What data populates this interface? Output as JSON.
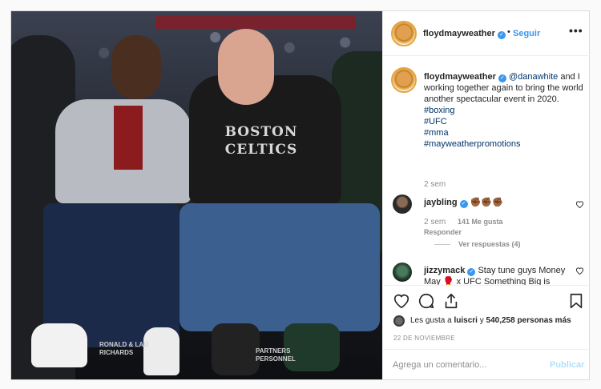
{
  "post": {
    "author": "floydmayweather",
    "follow_label": "Seguir",
    "separator": "•",
    "more_label": "•••",
    "caption": {
      "author": "floydmayweather",
      "mention": "@danawhite",
      "text": " and I working together again to bring the world another spectacular event in 2020.",
      "tags": [
        "#boxing",
        "#UFC",
        "#mma",
        "#mayweatherpromotions"
      ],
      "time": "2 sem"
    },
    "comments": [
      {
        "user": "jaybling",
        "text": "✊🏾✊🏾✊🏾",
        "time": "2 sem",
        "likes": "141 Me gusta",
        "reply_label": "Responder",
        "view_replies": "Ver respuestas (4)"
      },
      {
        "user": "jizzymack",
        "text_before": "Stay tune guys Money May ",
        "text_after": " x UFC Something Big is about to be",
        "emoji": "🥊"
      }
    ],
    "likes_text_prefix": "Les gusta a ",
    "likes_user": "luiscri",
    "likes_text_mid": " y ",
    "likes_count": "540,258 personas más",
    "date": "22 DE NOVIEMBRE",
    "comment_placeholder": "Agrega un comentario...",
    "publish_label": "Publicar",
    "photo": {
      "shirt_line1": "BOSTON",
      "shirt_line2": "CELTICS",
      "sign_left_1": "RONALD & LAU",
      "sign_left_2": "RICHARDS",
      "sign_right_1": "PARTNERS",
      "sign_right_2": "PERSONNEL"
    }
  },
  "colors": {
    "link": "#3897f0",
    "hashtag": "#003569",
    "muted": "#8e8e8e",
    "border": "#dbdbdb"
  },
  "icons": [
    "heart-icon",
    "comment-icon",
    "share-icon",
    "bookmark-icon",
    "verified-icon",
    "more-icon"
  ]
}
